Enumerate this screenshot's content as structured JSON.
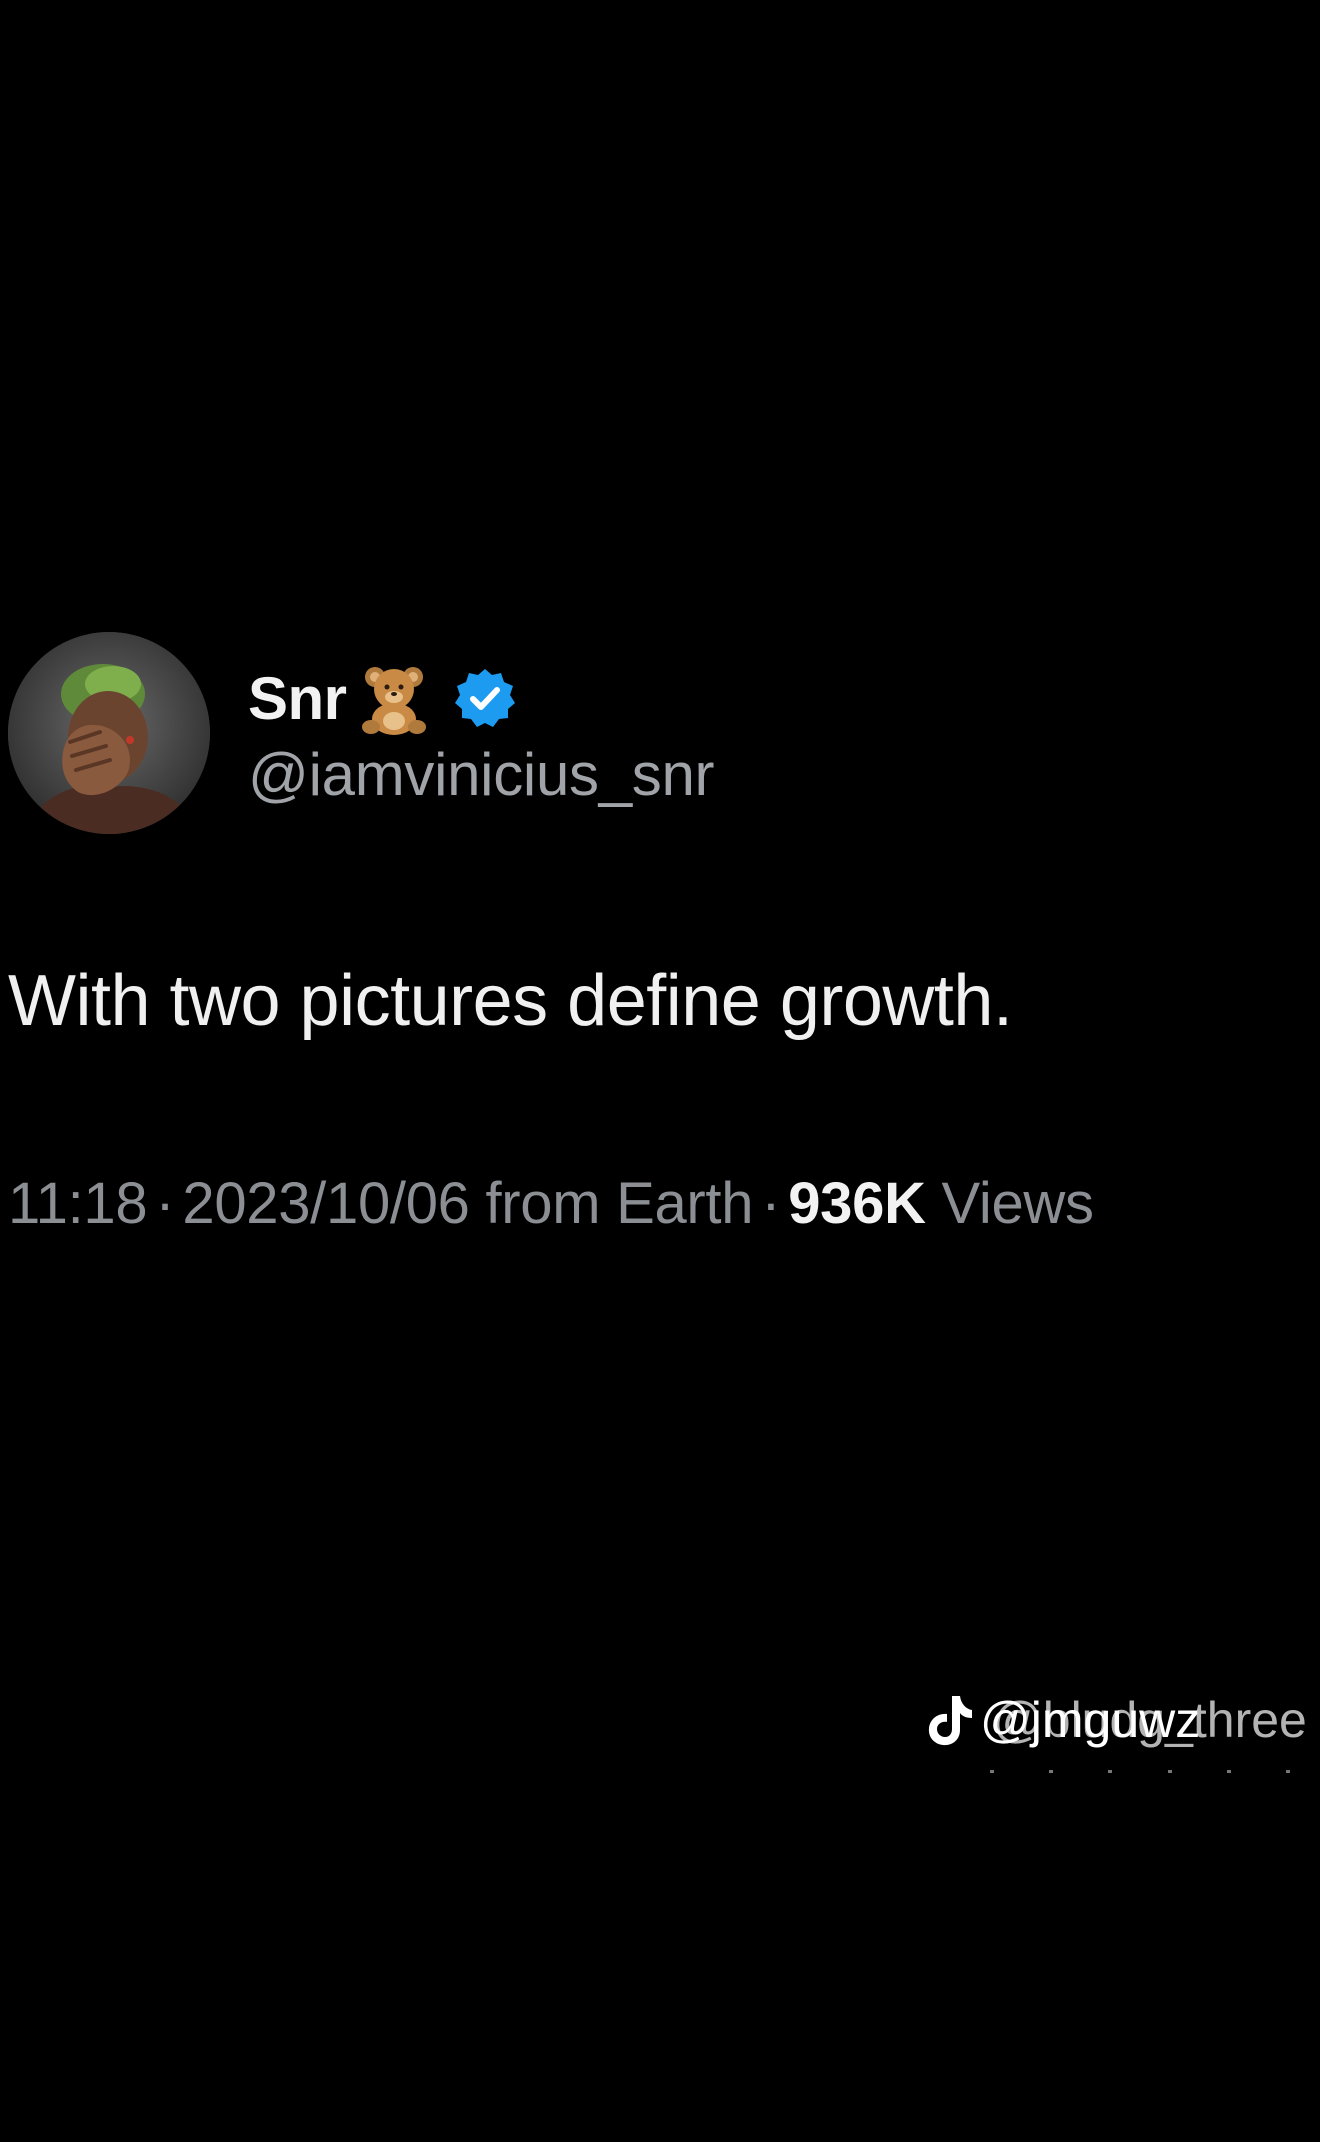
{
  "tweet": {
    "author": {
      "display_name": "Snr",
      "name_emoji_icon": "teddy-bear-icon",
      "verified_icon": "verified-badge-icon",
      "handle": "@iamvinicius_snr",
      "avatar": "profile-photo"
    },
    "text": "With two pictures define growth.",
    "meta": {
      "time": "11:18",
      "separator": "·",
      "date_source": "2023/10/06 from Earth",
      "views_count": "936K",
      "views_label": "Views"
    }
  },
  "watermark": {
    "icon": "tiktok-logo-icon",
    "text_primary": "@jmguwz",
    "text_secondary": "@bludg_three"
  },
  "colors": {
    "background": "#000000",
    "primary_text": "#f0f0f0",
    "secondary_text": "#8b8f94",
    "verified_blue": "#1d9bf0"
  }
}
